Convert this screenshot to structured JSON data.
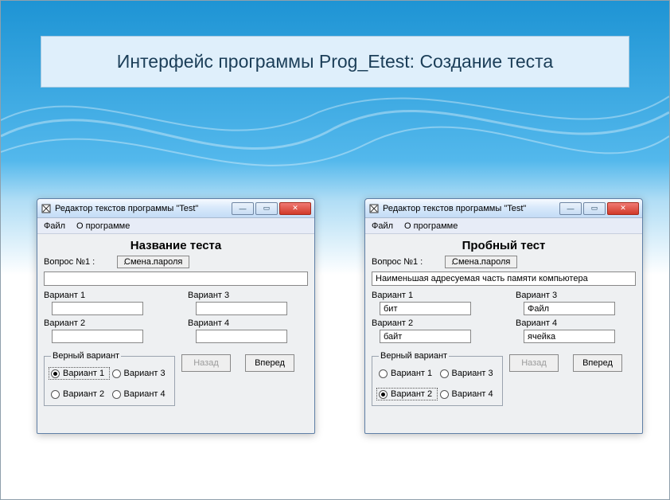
{
  "slide_title": "Интерфейс программы Prog_Etest: Создание теста",
  "windows": {
    "left": {
      "titlebar": "Редактор текстов программы \"Test\"",
      "menu": {
        "file": "Файл",
        "about": "О программе"
      },
      "test_title": "Название теста",
      "question_label": "Вопрос №1 :",
      "pw_button": "Смена пароля",
      "question_value": "",
      "variants": {
        "v1_label": "Вариант 1",
        "v1_value": "",
        "v2_label": "Вариант 2",
        "v2_value": "",
        "v3_label": "Вариант 3",
        "v3_value": "",
        "v4_label": "Вариант 4",
        "v4_value": ""
      },
      "correct_legend": "Верный вариант",
      "radios": {
        "r1": "Вариант 1",
        "r2": "Вариант 2",
        "r3": "Вариант 3",
        "r4": "Вариант 4"
      },
      "selected_radio": "r1",
      "nav": {
        "back": "Назад",
        "back_disabled": true,
        "forward": "Вперед"
      }
    },
    "right": {
      "titlebar": "Редактор текстов программы \"Test\"",
      "menu": {
        "file": "Файл",
        "about": "О программе"
      },
      "test_title": "Пробный тест",
      "question_label": "Вопрос №1 :",
      "pw_button": "Смена пароля",
      "question_value": "Наименьшая адресуемая часть памяти компьютера",
      "variants": {
        "v1_label": "Вариант 1",
        "v1_value": "бит",
        "v2_label": "Вариант 2",
        "v2_value": "байт",
        "v3_label": "Вариант 3",
        "v3_value": "Файл",
        "v4_label": "Вариант 4",
        "v4_value": "ячейка"
      },
      "correct_legend": "Верный вариант",
      "radios": {
        "r1": "Вариант 1",
        "r2": "Вариант 2",
        "r3": "Вариант 3",
        "r4": "Вариант 4"
      },
      "selected_radio": "r2",
      "nav": {
        "back": "Назад",
        "back_disabled": true,
        "forward": "Вперед"
      }
    }
  },
  "win_controls": {
    "min": "—",
    "max": "▭",
    "close": "✕"
  }
}
